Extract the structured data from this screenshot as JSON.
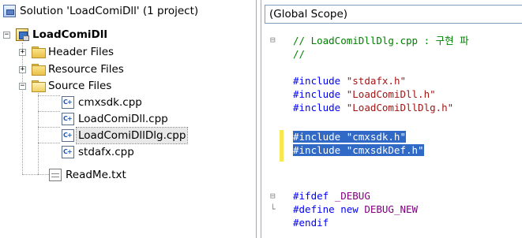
{
  "solution_explorer": {
    "solution_label": "Solution 'LoadComiDll' (1 project)",
    "project_label": "LoadComiDll",
    "folders": {
      "header": "Header Files",
      "resource": "Resource Files",
      "source": "Source Files"
    },
    "source_files": [
      "cmxsdk.cpp",
      "LoadComiDll.cpp",
      "LoadComiDllDlg.cpp",
      "stdafx.cpp"
    ],
    "readme": "ReadMe.txt",
    "expander_collapsed": "+",
    "expander_expanded": "−",
    "cpp_icon_glyph": "C+"
  },
  "editor": {
    "scope_combo": "(Global Scope)",
    "lines": {
      "l1": "// LoadComiDllDlg.cpp : 구현 파",
      "l2": "//",
      "inc1_kw": "#include",
      "inc1_str": "\"stdafx.h\"",
      "inc2_kw": "#include",
      "inc2_str": "\"LoadComiDll.h\"",
      "inc3_kw": "#include",
      "inc3_str": "\"LoadComiDllDlg.h\"",
      "sel1": "#include \"cmxsdk.h\"",
      "sel2": "#include \"cmxsdkDef.h\"",
      "ifdef_kw": "#ifdef",
      "ifdef_macro": "_DEBUG",
      "define_kw": "#define",
      "define_name": "new",
      "define_macro": "DEBUG_NEW",
      "endif_kw": "#endif"
    },
    "outline_collapse": "⊟",
    "outline_end": "└"
  },
  "colors": {
    "preprocessor": "#0000ff",
    "string": "#a31515",
    "comment": "#008000",
    "macro": "#800080",
    "selection": "#3169c6",
    "change_bar": "#f5e94f"
  }
}
